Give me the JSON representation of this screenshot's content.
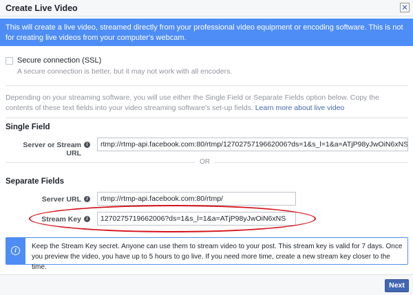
{
  "dialog": {
    "title": "Create Live Video",
    "close_glyph": "✕"
  },
  "banner": {
    "text": "This will create a live video, streamed directly from your professional video equipment or encoding software. This is not for creating live videos from your computer's webcam."
  },
  "ssl": {
    "label": "Secure connection (SSL)",
    "checked": false,
    "subtext": "A secure connection is better, but it may not work with all encoders."
  },
  "description": {
    "text": "Depending on your streaming software, you will use either the Single Field or Separate Fields option below. Copy the contents of these text fields into your video streaming software's set-up fields. ",
    "link": "Learn more about live video"
  },
  "single_field": {
    "heading": "Single Field",
    "label": "Server or Stream URL",
    "value": "rtmp://rtmp-api.facebook.com:80/rtmp/1270275719662006?ds=1&s_l=1&a=ATjP98yJwOiN6xNS"
  },
  "or_text": "OR",
  "separate_fields": {
    "heading": "Separate Fields",
    "server_label": "Server URL",
    "server_value": "rtmp://rtmp-api.facebook.com:80/rtmp/",
    "key_label": "Stream Key",
    "key_value": "1270275719662006?ds=1&s_l=1&a=ATjP98yJwOiN6xNS"
  },
  "info_glyph": "i",
  "notice": {
    "text": "Keep the Stream Key secret. Anyone can use them to stream video to your post. This stream key is valid for 7 days. Once you preview the video, you have up to 5 hours to go live. If you need more time, create a new stream key closer to the time."
  },
  "footer": {
    "next_label": "Next"
  },
  "colors": {
    "accent": "#4e8df5",
    "button": "#4267b2",
    "highlight": "#d5121b"
  },
  "icons": [
    "close-icon",
    "checkbox-icon",
    "info-icon"
  ]
}
